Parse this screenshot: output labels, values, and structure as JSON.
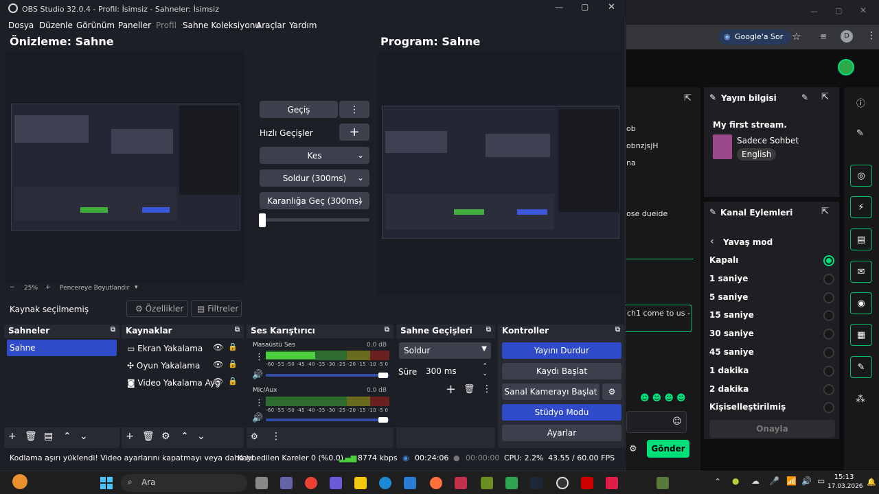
{
  "obs": {
    "title": "OBS Studio 32.0.4 - Profil: İsimsiz - Sahneler: İsimsiz",
    "menu": [
      "Dosya",
      "Düzenle",
      "Görünüm",
      "Paneller",
      "Profil",
      "Sahne Koleksiyonu",
      "Araçlar",
      "Yardım"
    ],
    "preview_title": "Önizleme: Sahne",
    "program_title": "Program: Sahne",
    "zoom": {
      "minus": "−",
      "value": "25%",
      "plus": "+",
      "fit": "Pencereye Boyutlandır"
    },
    "transition": {
      "gecis": "Geçiş",
      "quick": "Hızlı Geçişler",
      "cut": "Kes",
      "fade": "Soldur (300ms)",
      "fade_black": "Karanlığa Geç (300ms)"
    },
    "source_bar": {
      "none": "Kaynak seçilmemiş",
      "props": "Özellikler",
      "filters": "Filtreler"
    },
    "scenes": {
      "title": "Sahneler",
      "items": [
        "Sahne"
      ]
    },
    "sources": {
      "title": "Kaynaklar",
      "items": [
        "Ekran Yakalama",
        "Oyun Yakalama",
        "Video Yakalama Ayg"
      ]
    },
    "mixer": {
      "title": "Ses Karıştırıcı",
      "channels": [
        {
          "name": "Masaüstü Ses",
          "db": "0.0 dB"
        },
        {
          "name": "Mic/Aux",
          "db": "0.0 dB"
        }
      ],
      "ticks": "-60 -55 -50 -45 -40 -35 -30 -25 -20 -15 -10  -5   0"
    },
    "transitions_dock": {
      "title": "Sahne Geçişleri",
      "selected": "Soldur",
      "duration_label": "Süre",
      "duration": "300 ms"
    },
    "controls": {
      "title": "Kontroller",
      "stop_stream": "Yayını Durdur",
      "start_rec": "Kaydı Başlat",
      "virtual_cam": "Sanal Kamerayı Başlat",
      "studio": "Stüdyo Modu",
      "settings": "Ayarlar"
    },
    "status": {
      "warning": "Kodlama aşırı yüklendi! Video ayarlarını kapatmayı veya daha hı",
      "dropped": "Kaybedilen Kareler 0 (%0.0)",
      "kbps": "8774 kbps",
      "live_time": "00:24:06",
      "rec_time": "00:00:00",
      "cpu": "CPU: 2.2%",
      "fps": "43.55 / 60.00 FPS"
    },
    "colors": {
      "accent": "#2f4bc9",
      "bg": "#1d1f26",
      "dock": "#272a33"
    }
  },
  "browser": {
    "search_btn": "Google'a Sor",
    "chat_frag": [
      "ob",
      "obnzjsjH",
      "na",
      "ose dueide",
      "ch1 come to us -"
    ],
    "send": "Gönder",
    "stream_info": {
      "title": "Yayın bilgisi",
      "stream_title": "My first stream.",
      "category": "Sadece Sohbet",
      "tag": "English"
    },
    "channel_actions": {
      "title": "Kanal Eylemleri",
      "back": "Yavaş mod",
      "options": [
        "Kapalı",
        "1 saniye",
        "5 saniye",
        "15 saniye",
        "30 saniye",
        "45 saniye",
        "1 dakika",
        "2 dakika",
        "Kişiselleştirilmiş"
      ],
      "selected": 0,
      "confirm": "Onayla"
    }
  },
  "taskbar": {
    "search": "Ara",
    "time": "15:13",
    "date": "17.03.2026"
  }
}
